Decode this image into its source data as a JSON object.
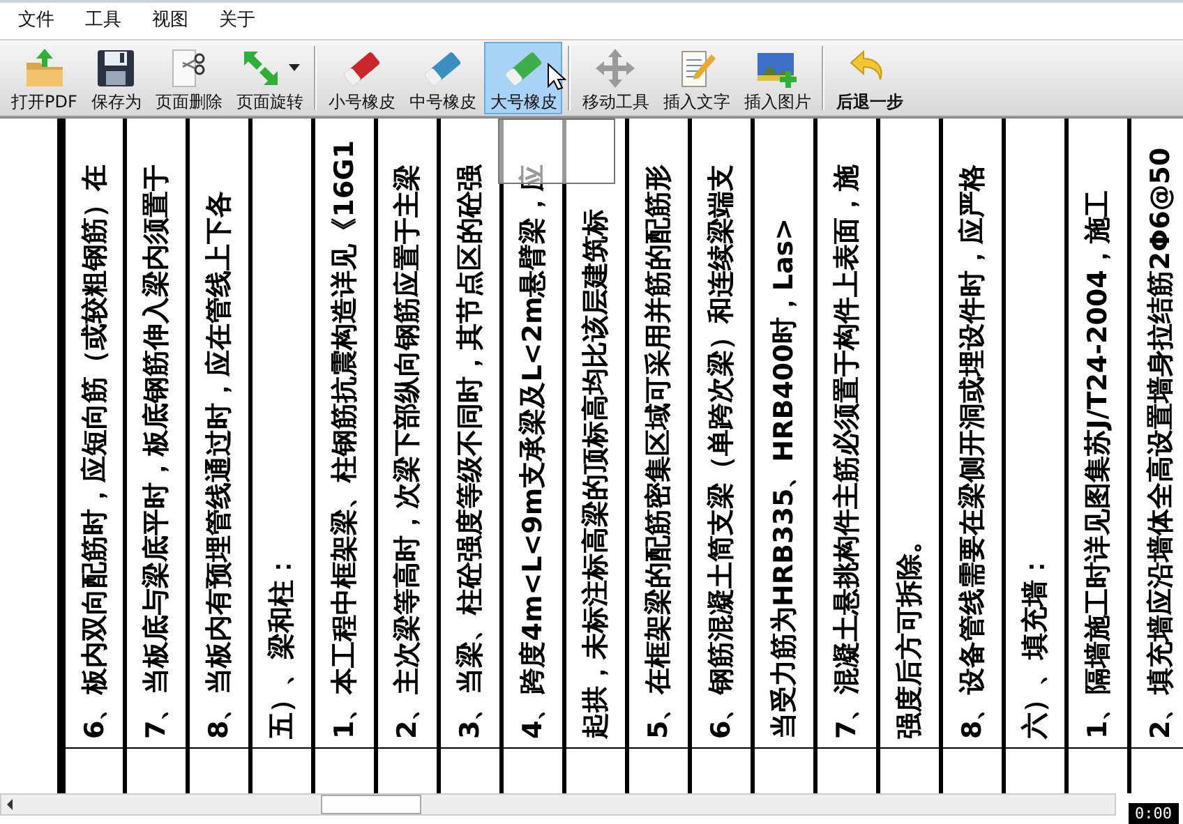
{
  "menu": [
    {
      "label": "文件"
    },
    {
      "label": "工具"
    },
    {
      "label": "视图"
    },
    {
      "label": "关于"
    }
  ],
  "toolbar": {
    "groups": [
      {
        "items": [
          {
            "label": "打开PDF",
            "kind": "button",
            "selected": false
          },
          {
            "label": "保存为",
            "kind": "button",
            "selected": false
          },
          {
            "label": "页面删除",
            "kind": "button",
            "selected": false
          },
          {
            "label": "页面旋转",
            "kind": "dropdown",
            "selected": false
          }
        ]
      },
      {
        "items": [
          {
            "label": "小号橡皮",
            "kind": "button",
            "selected": false
          },
          {
            "label": "中号橡皮",
            "kind": "button",
            "selected": false
          },
          {
            "label": "大号橡皮",
            "kind": "button",
            "selected": true
          }
        ]
      },
      {
        "items": [
          {
            "label": "移动工具",
            "kind": "button",
            "selected": false
          },
          {
            "label": "插入文字",
            "kind": "button",
            "selected": false
          },
          {
            "label": "插入图片",
            "kind": "button",
            "selected": false
          }
        ]
      },
      {
        "items": [
          {
            "label": "后退一步",
            "kind": "strong",
            "selected": false
          }
        ]
      }
    ]
  },
  "document": {
    "lines": [
      "6、板内双向配筋时，应短向筋（或较粗钢筋）在",
      "7、当板底与梁底平时，板底钢筋伸入梁内须置于",
      "8、当板内有预埋管线通过时，应在管线上下各",
      "五）、梁和柱：",
      "1、本工程中框架梁、柱钢筋抗震构造详见《16G1",
      "2、主次梁等高时，次梁下部纵向钢筋应置于主梁",
      "3、当梁、柱砼强度等级不同时，其节点区的砼强",
      "4、跨度4m<L<9m支承梁及L<2m悬臂梁，应",
      "起拱，未标注标高梁的顶标高均比该层建筑标",
      "5、在框架梁的配筋密集区域可采用并筋的配筋形",
      "6、钢筋混凝土简支梁（单跨次梁）和连续梁端支",
      "当受力筋为HRB335、HRB400时，Las>",
      "7、混凝土悬挑构件主筋必须置于构件上表面，施",
      "强度后方可拆除。",
      "8、设备管线需要在梁侧开洞或埋设件时，应严格",
      "六）、填充墙：",
      "1、隔墙施工时详见图集苏J/T24-2004，施工",
      "2、填充墙应沿墙体全高设置墙身拉结筋2Φ6@50"
    ]
  },
  "status_bar": {
    "timer": "0:00"
  }
}
